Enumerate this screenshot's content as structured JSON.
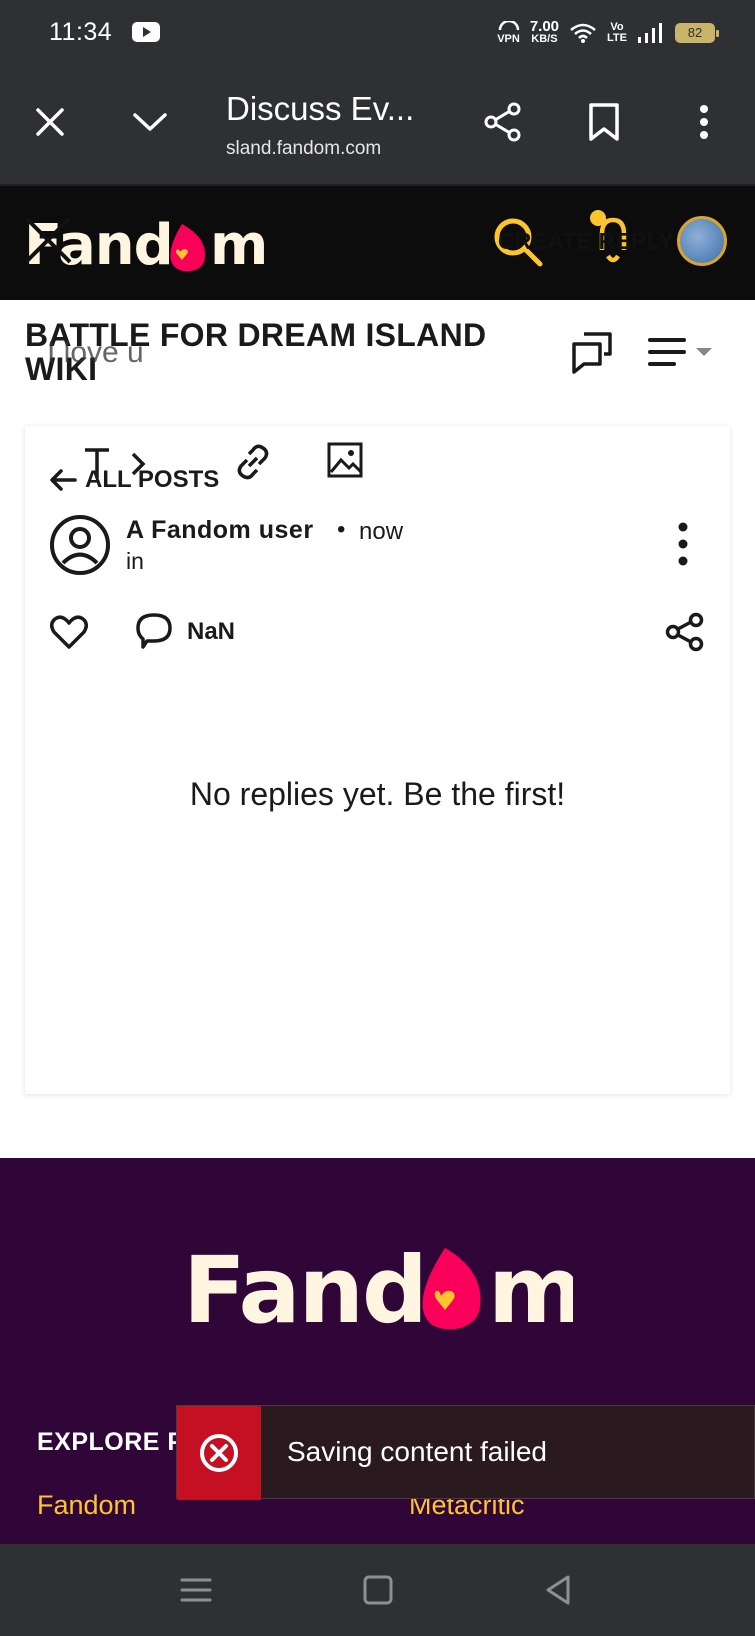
{
  "status_bar": {
    "time": "11:34",
    "speed_value": "7.00",
    "speed_unit": "KB/S",
    "vpn_label": "VPN",
    "volte_top": "Vo",
    "volte_bottom": "LTE",
    "battery": "82"
  },
  "browser": {
    "title": "Discuss Ev...",
    "url": "sland.fandom.com",
    "close_icon": "close-icon",
    "chevron_icon": "chevron-down-icon",
    "share_icon": "share-icon",
    "bookmark_icon": "bookmark-icon",
    "menu_icon": "more-vertical-icon"
  },
  "fandom_header": {
    "logo": "Fandom",
    "create_reply": "CREATE REPLY"
  },
  "wiki": {
    "title": "BATTLE FOR DREAM ISLAND WIKI",
    "draft_text": "I love u"
  },
  "post": {
    "back_label": "ALL POSTS",
    "user_name": "A Fandom user",
    "separator": "•",
    "time": "now",
    "location": "in",
    "comment_count": "NaN",
    "empty_message": "No replies yet. Be the first!"
  },
  "footer": {
    "logo": "Fandom",
    "explore_heading": "EXPLORE P",
    "link_left": "Fandom",
    "link_right": "Metacritic"
  },
  "toast": {
    "message": "Saving content failed"
  },
  "colors": {
    "fandom_yellow": "#fdc52d",
    "fandom_pink": "#fa005a",
    "footer_bg": "#300538",
    "error_red": "#c50f23"
  }
}
